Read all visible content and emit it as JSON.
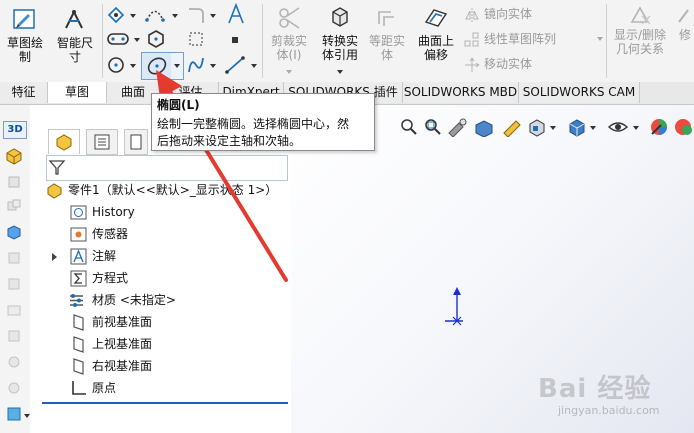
{
  "ribbon": {
    "sketch_label": "草图绘\n制",
    "smart_dim_label": "智能尺\n寸",
    "trim_label": "剪裁实\n体(I)",
    "convert_label": "转换实\n体引用",
    "offset_label": "等距实\n体",
    "surface_offset_label": "曲面上\n偏移",
    "mirror_label": "镜向实体",
    "linear_pattern_label": "线性草图阵列",
    "move_label": "移动实体",
    "show_delete_label": "显示/删除\n几何关系",
    "repair_label": "修"
  },
  "tabs": [
    {
      "label": "特征"
    },
    {
      "label": "草图"
    },
    {
      "label": "曲面"
    },
    {
      "label": "评估"
    },
    {
      "label": "DimXpert"
    },
    {
      "label": "SOLIDWORKS 插件"
    },
    {
      "label": "SOLIDWORKS MBD"
    },
    {
      "label": "SOLIDWORKS CAM"
    }
  ],
  "tooltip": {
    "title": "椭圆(L)",
    "line1": "绘制一完整椭圆。选择椭圆中心，然",
    "line2": "后拖动来设定主轴和次轴。"
  },
  "tree": {
    "part": "零件1（默认<<默认>_显示状态 1>）",
    "history": "History",
    "sensors": "传感器",
    "annotations": "注解",
    "equations": "方程式",
    "material": "材质 <未指定>",
    "front_plane": "前视基准面",
    "top_plane": "上视基准面",
    "right_plane": "右视基准面",
    "origin": "原点"
  },
  "left_strip": {
    "top_label": "3D"
  },
  "watermark": {
    "brand": "Bai 经验",
    "sub": "jingyan.baidu.com"
  },
  "colors": {
    "accent_arrow": "#e53a2f",
    "axis_blue": "#1c2fd0",
    "ribbon_bg": "#f3f3f3"
  }
}
